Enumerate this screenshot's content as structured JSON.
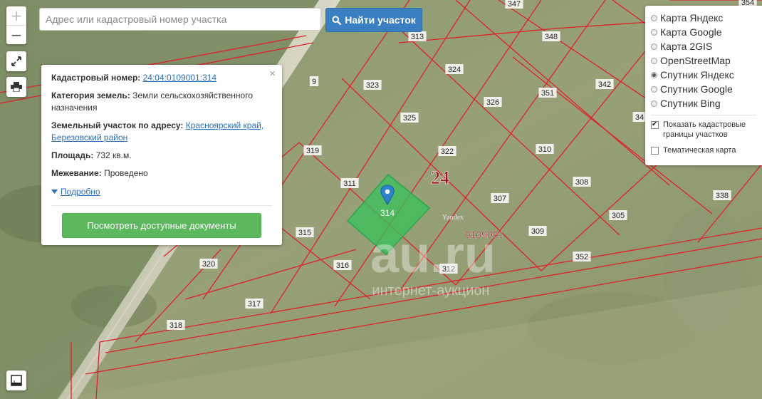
{
  "search": {
    "placeholder": "Адрес или кадастровый номер участка",
    "button_label": "Найти участок"
  },
  "controls": {
    "zoom_in": "+",
    "zoom_out": "−"
  },
  "info_panel": {
    "cadastral_label": "Кадастровый номер:",
    "cadastral_value": "24:04:0109001:314",
    "category_label": "Категория земель:",
    "category_value": "Земли сельскохозяйственного назначения",
    "address_label": "Земельный участок по адресу:",
    "address_value": "Красноярский край, Березовский район",
    "area_label": "Площадь:",
    "area_value": "732 кв.м.",
    "survey_label": "Межевание:",
    "survey_value": "Проведено",
    "details_link": "Подробно",
    "docs_button": "Посмотреть доступные документы",
    "close": "×"
  },
  "layers": {
    "options": [
      {
        "label": "Карта Яндекс",
        "selected": false
      },
      {
        "label": "Карта Google",
        "selected": false
      },
      {
        "label": "Карта 2GIS",
        "selected": false
      },
      {
        "label": "OpenStreetMap",
        "selected": false
      },
      {
        "label": "Спутник Яндекс",
        "selected": true
      },
      {
        "label": "Спутник Google",
        "selected": false
      },
      {
        "label": "Спутник Bing",
        "selected": false
      }
    ],
    "show_boundaries_label": "Показать кадастровые границы участков",
    "show_boundaries_checked": true,
    "thematic_label": "Тематическая карта",
    "thematic_checked": false
  },
  "map": {
    "region_label": "24",
    "quarter_label": "0109001",
    "yandex_label": "Yandex",
    "watermark": "au.ru",
    "watermark_sub": "интернет-аукцион",
    "marker_label": "314",
    "parcels": [
      "347",
      "348",
      "313",
      "324",
      "323",
      "351",
      "342",
      "34",
      "9",
      "325",
      "326",
      "319",
      "322",
      "310",
      "311",
      "307",
      "308",
      "338",
      "315",
      "309",
      "305",
      "316",
      "312",
      "352",
      "320",
      "317",
      "318",
      "354"
    ]
  },
  "colors": {
    "boundary": "#e0202a",
    "selected_parcel": "#35c35a",
    "marker": "#2b82cb",
    "search_button": "#3a7fc1",
    "docs_button": "#5cb85c"
  }
}
